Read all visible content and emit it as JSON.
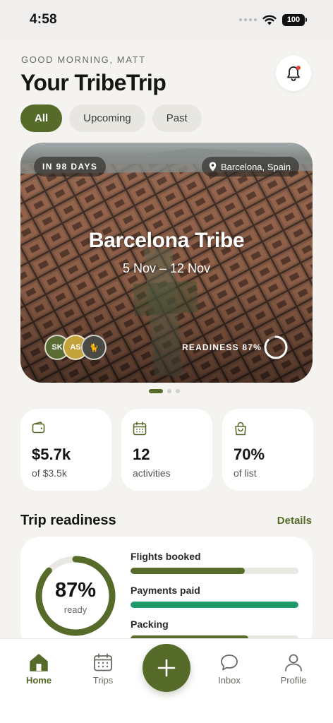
{
  "status_bar": {
    "time": "4:58",
    "battery": "100"
  },
  "header": {
    "greeting": "GOOD MORNING, MATT",
    "title": "Your TribeTrip"
  },
  "filters": [
    {
      "label": "All",
      "active": true
    },
    {
      "label": "Upcoming",
      "active": false
    },
    {
      "label": "Past",
      "active": false
    }
  ],
  "hero": {
    "countdown": "IN 98 DAYS",
    "location": "Barcelona, Spain",
    "title": "Barcelona Tribe",
    "dates": "5 Nov – 12 Nov",
    "members": [
      "SK",
      "AS",
      "🐈"
    ],
    "readiness_label": "READINESS 87%",
    "readiness_value": 0.87,
    "pager": {
      "count": 3,
      "active": 0
    }
  },
  "stats": [
    {
      "icon": "wallet-icon",
      "value": "$5.7k",
      "sub": "of $3.5k"
    },
    {
      "icon": "calendar-icon",
      "value": "12",
      "sub": "activities"
    },
    {
      "icon": "bag-icon",
      "value": "70%",
      "sub": "of list"
    }
  ],
  "readiness": {
    "title": "Trip readiness",
    "link": "Details",
    "gauge_value": "87%",
    "gauge_label": "ready",
    "gauge_fraction": 0.87,
    "items": [
      {
        "label": "Flights booked",
        "fraction": 0.68,
        "color": "#566b2a"
      },
      {
        "label": "Payments paid",
        "fraction": 1.0,
        "color": "#1f9a6b"
      },
      {
        "label": "Packing",
        "fraction": 0.7,
        "color": "#566b2a"
      }
    ]
  },
  "tab_bar": {
    "tabs": [
      {
        "label": "Home",
        "icon": "home-icon",
        "active": true
      },
      {
        "label": "Trips",
        "icon": "calendar-icon",
        "active": false
      },
      {
        "label": "Inbox",
        "icon": "chat-icon",
        "active": false
      },
      {
        "label": "Profile",
        "icon": "person-icon",
        "active": false
      }
    ],
    "fab_icon": "plus-icon"
  },
  "colors": {
    "accent": "#566b2a",
    "success": "#1f9a6b",
    "notification": "#e0493a",
    "background": "#f4f3ef"
  }
}
